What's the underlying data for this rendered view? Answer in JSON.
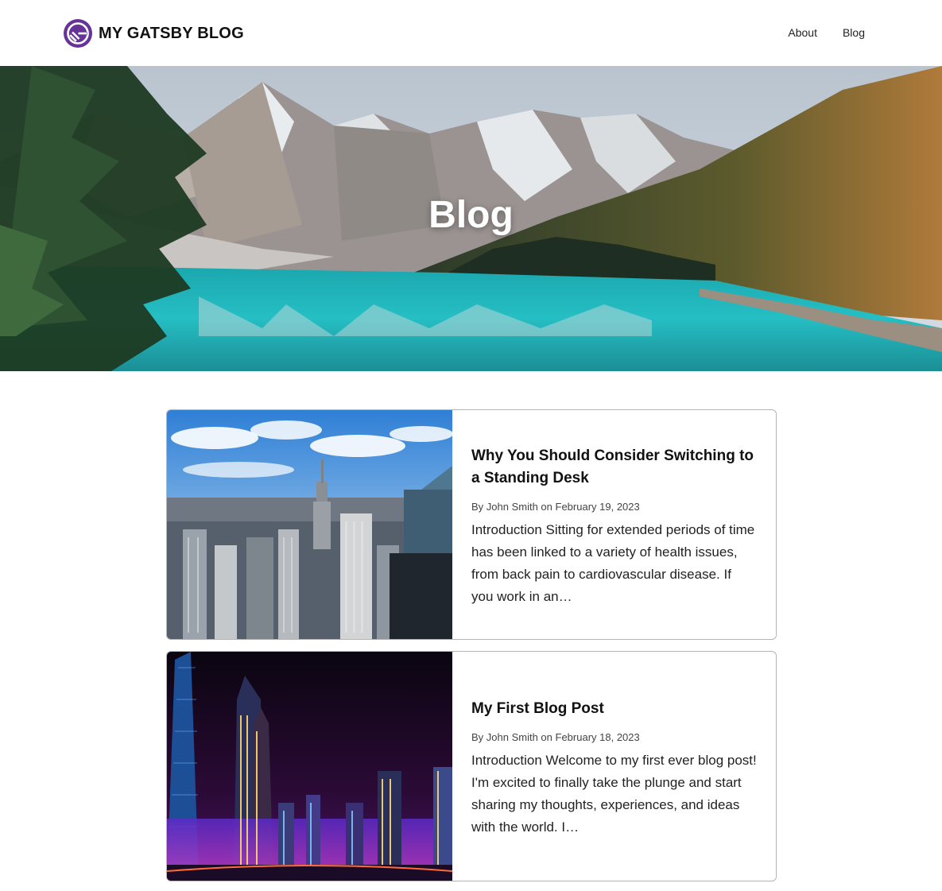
{
  "header": {
    "logo_icon": "gatsby-logo-icon",
    "site_title": "MY GATSBY BLOG",
    "nav": [
      {
        "label": "About"
      },
      {
        "label": "Blog"
      }
    ]
  },
  "hero": {
    "title": "Blog",
    "image": "mountain-lake-hero-image"
  },
  "posts": [
    {
      "title": "Why You Should Consider Switching to a Standing Desk",
      "meta": "By John Smith on February 19, 2023",
      "excerpt": "Introduction Sitting for extended periods of time has been linked to a variety of health issues, from back pain to cardiovascular disease. If you work in an…",
      "image": "city-skyline-day-image"
    },
    {
      "title": "My First Blog Post",
      "meta": "By John Smith on February 18, 2023",
      "excerpt": "Introduction Welcome to my first ever blog post! I'm excited to finally take the plunge and start sharing my thoughts, experiences, and ideas with the world. I…",
      "image": "city-skyline-night-image"
    }
  ],
  "colors": {
    "brand_purple": "#663399",
    "lake_teal": "#1fb3b8",
    "card_border": "#b5b5b5"
  }
}
